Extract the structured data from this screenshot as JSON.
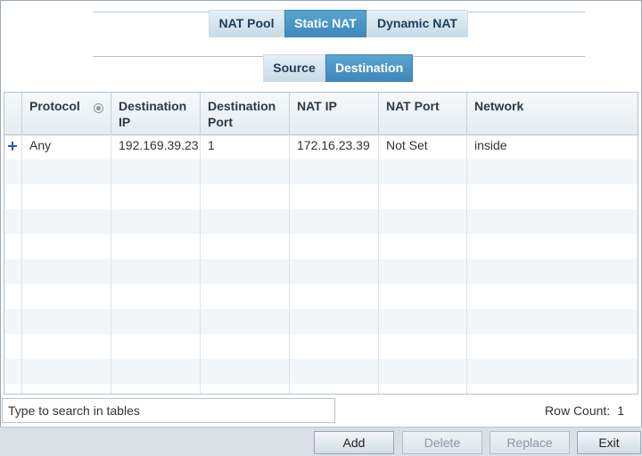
{
  "top_tabs": [
    {
      "label": "NAT Pool",
      "active": false
    },
    {
      "label": "Static NAT",
      "active": true
    },
    {
      "label": "Dynamic NAT",
      "active": false
    }
  ],
  "sub_tabs": [
    {
      "label": "Source",
      "active": false
    },
    {
      "label": "Destination",
      "active": true
    }
  ],
  "table": {
    "columns": [
      "Protocol",
      "Destination IP",
      "Destination Port",
      "NAT IP",
      "NAT Port",
      "Network"
    ],
    "rows": [
      [
        "Any",
        "192.169.39.23",
        "1",
        "172.16.23.39",
        "Not Set",
        "inside"
      ]
    ],
    "sort_column": "Protocol"
  },
  "search": {
    "placeholder": "Type to search in tables"
  },
  "row_count": {
    "label": "Row Count:",
    "value": "1"
  },
  "buttons": {
    "add": "Add",
    "delete": "Delete",
    "replace": "Replace",
    "exit": "Exit"
  },
  "colors": {
    "active_tab": "#3e88bc",
    "tab_bg": "#d4e4ef",
    "add_row_icon": "#2d55b8"
  }
}
